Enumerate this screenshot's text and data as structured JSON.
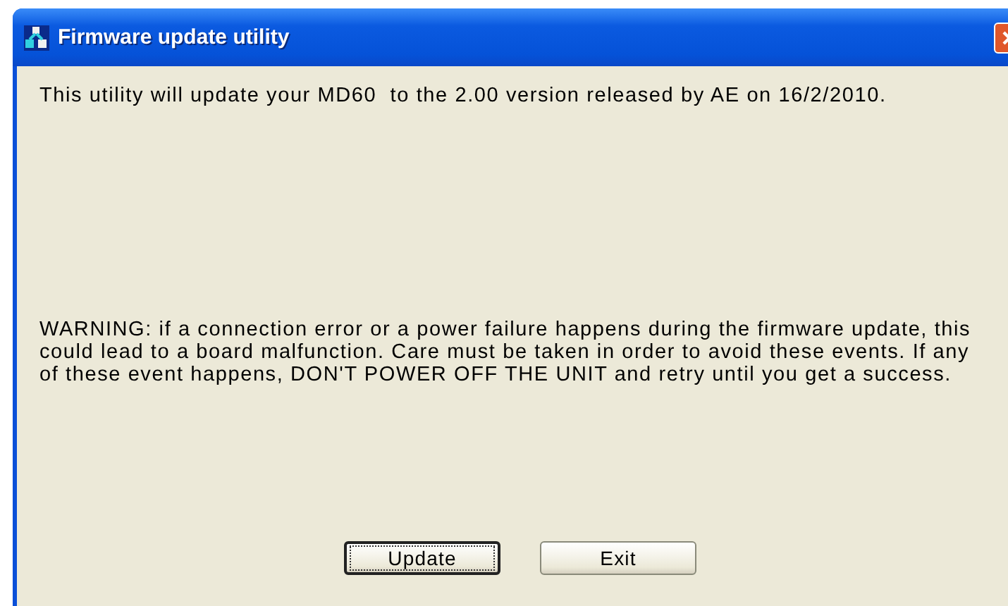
{
  "window": {
    "title": "Firmware update utility"
  },
  "message": "This utility will update your MD60  to the 2.00 version released by AE on 16/2/2010.",
  "warning": "WARNING: if a connection error or a power failure happens during the firmware update, this could lead to a board malfunction. Care must be taken in order to avoid these events. If any of these event happens, DON'T POWER OFF THE UNIT and retry until you get a success.",
  "buttons": [
    {
      "label": "Update",
      "focused": true
    },
    {
      "label": "Exit",
      "focused": false
    }
  ]
}
